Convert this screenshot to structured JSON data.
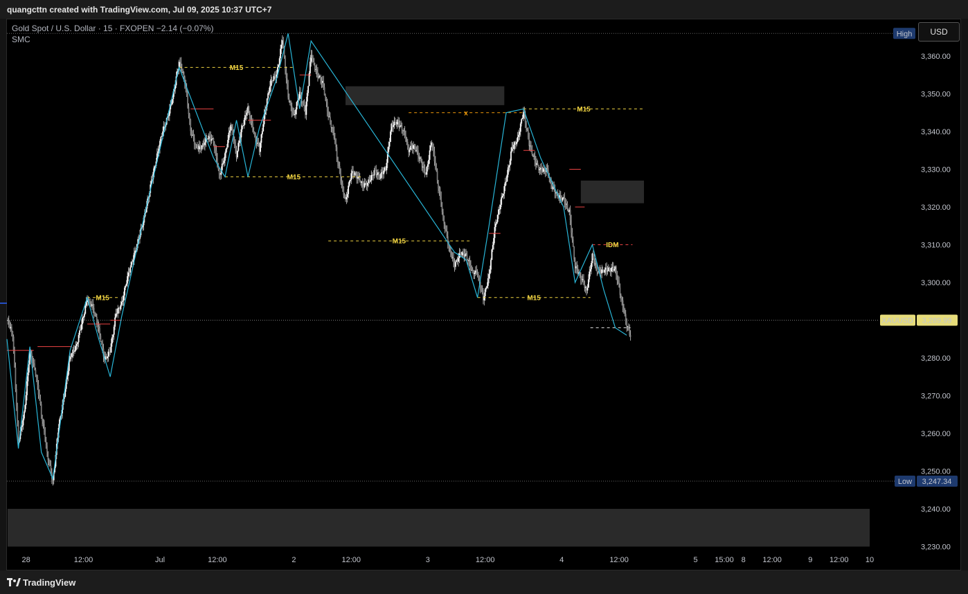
{
  "header": {
    "credit": "quangcttn created with TradingView.com, Jul 09, 2025 10:37 UTC+7"
  },
  "legend": {
    "symbol_line": "Gold Spot / U.S. Dollar · 15 · FXOPEN  −2.14 (−0.07%)",
    "indicator": "SMC"
  },
  "toolbar": {
    "currency_button": "USD"
  },
  "footer": {
    "brand": "TradingView"
  },
  "colors": {
    "bull_bear": "#ffffff",
    "zigzag": "#29b6d8",
    "structure": "#f2d542",
    "choch": "#ef4444",
    "zone": "#2a2a2a"
  },
  "chart_data": {
    "type": "line",
    "symbol": "XAUUSD",
    "timeframe": "15",
    "ylim": [
      3230,
      3366
    ],
    "y_ticks": [
      3360,
      3350,
      3340,
      3330,
      3320,
      3310,
      3300,
      3290,
      3280,
      3270,
      3260,
      3250,
      3240,
      3230
    ],
    "y_tick_labels": [
      "3,360.00",
      "3,350.00",
      "3,340.00",
      "3,330.00",
      "3,320.00",
      "3,310.00",
      "3,300.00",
      "3,290.00",
      "3,280.00",
      "3,270.00",
      "3,260.00",
      "3,250.00",
      "3,240.00",
      "3,230.00"
    ],
    "x_ticks": [
      {
        "label": "28",
        "t": 10
      },
      {
        "label": "12:00",
        "t": 40
      },
      {
        "label": "Jul",
        "t": 80
      },
      {
        "label": "12:00",
        "t": 110
      },
      {
        "label": "2",
        "t": 150
      },
      {
        "label": "12:00",
        "t": 180
      },
      {
        "label": "3",
        "t": 220
      },
      {
        "label": "12:00",
        "t": 250
      },
      {
        "label": "4",
        "t": 290
      },
      {
        "label": "12:00",
        "t": 320
      },
      {
        "label": "5",
        "t": 360
      },
      {
        "label": "15:00",
        "t": 375
      },
      {
        "label": "8",
        "t": 385
      },
      {
        "label": "12:00",
        "t": 400
      },
      {
        "label": "9",
        "t": 420
      },
      {
        "label": "12:00",
        "t": 435
      },
      {
        "label": "10",
        "t": 451
      }
    ],
    "price_series": [
      [
        0,
        3290
      ],
      [
        3,
        3285
      ],
      [
        6,
        3257
      ],
      [
        9,
        3266
      ],
      [
        12,
        3283
      ],
      [
        15,
        3276
      ],
      [
        18,
        3264
      ],
      [
        21,
        3254
      ],
      [
        24,
        3248
      ],
      [
        27,
        3263
      ],
      [
        30,
        3270
      ],
      [
        33,
        3279
      ],
      [
        36,
        3282
      ],
      [
        39,
        3290
      ],
      [
        42,
        3297
      ],
      [
        45,
        3293
      ],
      [
        48,
        3286
      ],
      [
        51,
        3279
      ],
      [
        54,
        3283
      ],
      [
        57,
        3293
      ],
      [
        60,
        3294
      ],
      [
        63,
        3300
      ],
      [
        66,
        3306
      ],
      [
        69,
        3313
      ],
      [
        72,
        3319
      ],
      [
        75,
        3325
      ],
      [
        78,
        3331
      ],
      [
        81,
        3339
      ],
      [
        84,
        3345
      ],
      [
        87,
        3351
      ],
      [
        90,
        3358
      ],
      [
        93,
        3352
      ],
      [
        96,
        3340
      ],
      [
        99,
        3337
      ],
      [
        102,
        3337
      ],
      [
        105,
        3338
      ],
      [
        108,
        3336
      ],
      [
        111,
        3328
      ],
      [
        114,
        3335
      ],
      [
        117,
        3343
      ],
      [
        120,
        3333
      ],
      [
        123,
        3340
      ],
      [
        126,
        3346
      ],
      [
        129,
        3341
      ],
      [
        132,
        3336
      ],
      [
        135,
        3345
      ],
      [
        138,
        3352
      ],
      [
        141,
        3355
      ],
      [
        144,
        3366
      ],
      [
        147,
        3350
      ],
      [
        150,
        3343
      ],
      [
        153,
        3349
      ],
      [
        156,
        3345
      ],
      [
        159,
        3362
      ],
      [
        162,
        3356
      ],
      [
        165,
        3352
      ],
      [
        168,
        3343
      ],
      [
        171,
        3339
      ],
      [
        174,
        3330
      ],
      [
        177,
        3322
      ],
      [
        180,
        3328
      ],
      [
        183,
        3327
      ],
      [
        186,
        3326
      ],
      [
        189,
        3328
      ],
      [
        192,
        3330
      ],
      [
        195,
        3327
      ],
      [
        198,
        3329
      ],
      [
        201,
        3342
      ],
      [
        204,
        3344
      ],
      [
        207,
        3341
      ],
      [
        210,
        3334
      ],
      [
        213,
        3335
      ],
      [
        216,
        3333
      ],
      [
        219,
        3330
      ],
      [
        222,
        3338
      ],
      [
        225,
        3326
      ],
      [
        228,
        3316
      ],
      [
        231,
        3310
      ],
      [
        234,
        3306
      ],
      [
        237,
        3308
      ],
      [
        240,
        3306
      ],
      [
        243,
        3302
      ],
      [
        246,
        3303
      ],
      [
        249,
        3297
      ],
      [
        252,
        3302
      ],
      [
        255,
        3313
      ],
      [
        258,
        3320
      ],
      [
        261,
        3328
      ],
      [
        264,
        3337
      ],
      [
        267,
        3338
      ],
      [
        270,
        3344
      ],
      [
        273,
        3336
      ],
      [
        276,
        3333
      ],
      [
        279,
        3331
      ],
      [
        282,
        3330
      ],
      [
        285,
        3324
      ],
      [
        288,
        3322
      ],
      [
        291,
        3323
      ],
      [
        294,
        3320
      ],
      [
        297,
        3304
      ],
      [
        300,
        3300
      ],
      [
        303,
        3297
      ],
      [
        306,
        3308
      ],
      [
        309,
        3304
      ],
      [
        312,
        3303
      ],
      [
        315,
        3302
      ],
      [
        318,
        3303
      ],
      [
        321,
        3297
      ],
      [
        324,
        3290
      ],
      [
        326,
        3286
      ]
    ],
    "zigzag": [
      [
        0,
        3285
      ],
      [
        6,
        3256
      ],
      [
        12,
        3283
      ],
      [
        18,
        3255
      ],
      [
        24,
        3248
      ],
      [
        33,
        3282
      ],
      [
        42,
        3296
      ],
      [
        48,
        3285
      ],
      [
        54,
        3275
      ],
      [
        60,
        3291
      ],
      [
        72,
        3318
      ],
      [
        90,
        3357
      ],
      [
        108,
        3333
      ],
      [
        114,
        3328
      ],
      [
        120,
        3343
      ],
      [
        126,
        3328
      ],
      [
        132,
        3341
      ],
      [
        141,
        3354
      ],
      [
        147,
        3366
      ],
      [
        153,
        3346
      ],
      [
        159,
        3364
      ],
      [
        234,
        3308
      ],
      [
        240,
        3306
      ],
      [
        246,
        3296
      ],
      [
        252,
        3315
      ],
      [
        261,
        3345
      ],
      [
        270,
        3346
      ],
      [
        279,
        3333
      ],
      [
        291,
        3320
      ],
      [
        297,
        3300
      ],
      [
        306,
        3310
      ],
      [
        312,
        3298
      ],
      [
        318,
        3288
      ],
      [
        324,
        3286
      ]
    ],
    "structure_lines": [
      {
        "label": "M15",
        "y": 3296,
        "t0": 42,
        "t1": 58,
        "color": "yellow"
      },
      {
        "label": "M15",
        "y": 3357,
        "t0": 90,
        "t1": 150,
        "color": "yellow"
      },
      {
        "label": "M15",
        "y": 3328,
        "t0": 114,
        "t1": 186,
        "color": "yellow"
      },
      {
        "label": "M15",
        "y": 3311,
        "t0": 168,
        "t1": 242,
        "color": "yellow"
      },
      {
        "label": "x",
        "y": 3345,
        "t0": 210,
        "t1": 270,
        "color": "orange"
      },
      {
        "label": "M15",
        "y": 3346,
        "t0": 270,
        "t1": 333,
        "color": "yellow"
      },
      {
        "label": "M15",
        "y": 3296,
        "t0": 246,
        "t1": 305,
        "color": "yellow"
      },
      {
        "label": "IDM",
        "y": 3310,
        "t0": 306,
        "t1": 327,
        "color": "red"
      },
      {
        "label": "",
        "y": 3288,
        "t0": 305,
        "t1": 326,
        "color": "white"
      }
    ],
    "choch_lines": [
      {
        "y": 3282,
        "t0": 0,
        "t1": 14
      },
      {
        "y": 3283,
        "t0": 16,
        "t1": 34
      },
      {
        "y": 3289,
        "t0": 42,
        "t1": 54
      },
      {
        "y": 3290,
        "t0": 54,
        "t1": 60
      },
      {
        "y": 3346,
        "t0": 96,
        "t1": 108
      },
      {
        "y": 3336,
        "t0": 108,
        "t1": 114
      },
      {
        "y": 3343,
        "t0": 126,
        "t1": 138
      },
      {
        "y": 3355,
        "t0": 153,
        "t1": 159
      },
      {
        "y": 3313,
        "t0": 252,
        "t1": 258
      },
      {
        "y": 3335,
        "t0": 270,
        "t1": 276
      },
      {
        "y": 3330,
        "t0": 294,
        "t1": 300
      },
      {
        "y": 3320,
        "t0": 297,
        "t1": 302
      }
    ],
    "zones": [
      {
        "t0": 177,
        "t1": 260,
        "y0": 3347,
        "y1": 3352
      },
      {
        "t0": 300,
        "t1": 333,
        "y0": 3321,
        "y1": 3327
      },
      {
        "t0": 0,
        "t1": 451,
        "y0": 3230,
        "y1": 3240
      }
    ],
    "high_marker": {
      "label": "High",
      "y": 3366
    },
    "low_marker": {
      "label": "Low",
      "value": "3,247.34",
      "y": 3247.34
    },
    "last_price": {
      "label": "XAUUSD",
      "value": "3,289.99",
      "y": 3289.99
    }
  }
}
